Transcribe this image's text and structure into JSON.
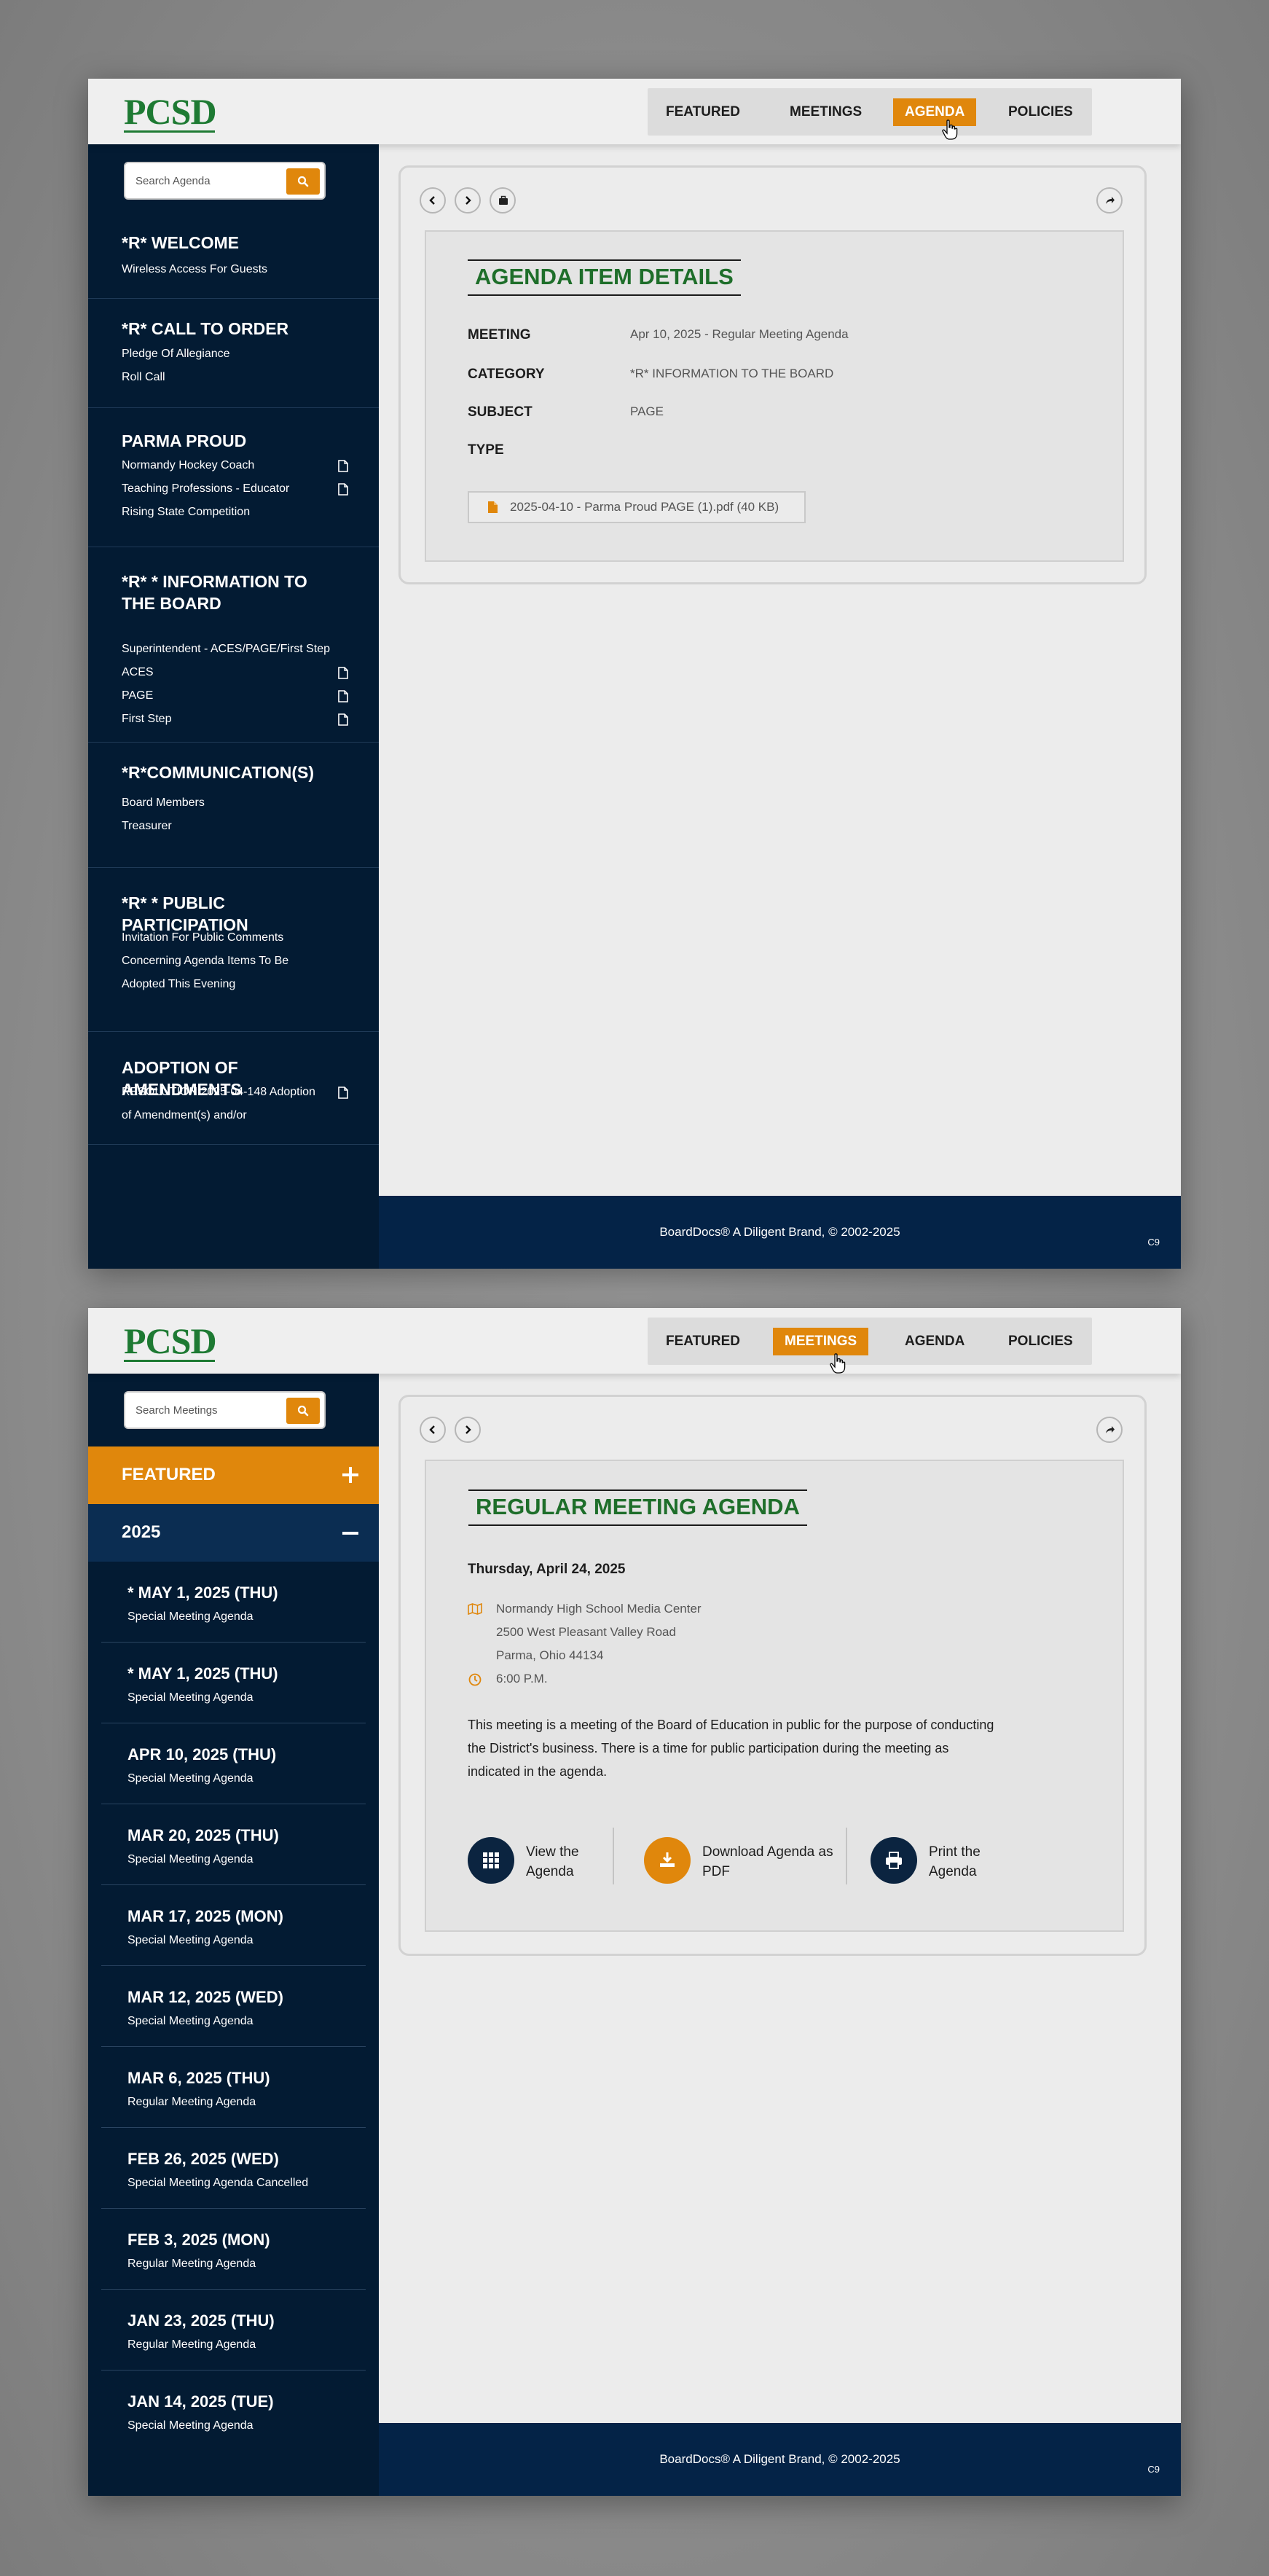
{
  "logo": "PCSD",
  "nav": [
    "FEATURED",
    "MEETINGS",
    "AGENDA",
    "POLICIES"
  ],
  "colors": {
    "brand_green": "#1e7a33",
    "accent_orange": "#e0870c",
    "sidebar_navy": "#031b33",
    "footer_navy": "#042347"
  },
  "footer": {
    "text": "BoardDocs® A Diligent Brand, © 2002-2025",
    "code": "C9"
  },
  "screen1": {
    "active_nav": "AGENDA",
    "search_placeholder": "Search Agenda",
    "sections": [
      {
        "title": "*R* WELCOME",
        "items": [
          {
            "label": "Wireless Access For Guests",
            "doc": false
          }
        ]
      },
      {
        "title": "*R* CALL TO ORDER",
        "items": [
          {
            "label": "Pledge Of Allegiance",
            "doc": false
          },
          {
            "label": "Roll Call",
            "doc": false
          }
        ]
      },
      {
        "title": "PARMA PROUD",
        "items": [
          {
            "label": "Normandy Hockey Coach",
            "doc": true
          },
          {
            "label": "Teaching Professions - Educator",
            "doc": true
          },
          {
            "label": "Rising State Competition",
            "doc": false
          }
        ]
      },
      {
        "title": "*R* * INFORMATION TO THE BOARD",
        "items": [
          {
            "label": "Superintendent - ACES/PAGE/First Step",
            "doc": false
          },
          {
            "label": "ACES",
            "doc": true
          },
          {
            "label": "PAGE",
            "doc": true
          },
          {
            "label": "First Step",
            "doc": true
          }
        ]
      },
      {
        "title": "*R*COMMUNICATION(S)",
        "items": [
          {
            "label": "Board Members",
            "doc": false
          },
          {
            "label": "Treasurer",
            "doc": false
          }
        ]
      },
      {
        "title": "*R* * PUBLIC PARTICIPATION",
        "items": [
          {
            "label": "Invitation For Public Comments",
            "doc": false
          },
          {
            "label": "Concerning Agenda Items To Be",
            "doc": false
          },
          {
            "label": "Adopted This Evening",
            "doc": false
          }
        ]
      },
      {
        "title": "ADOPTION OF AMENDMENTS",
        "items": [
          {
            "label": "RESOLUTION 2025-04-148 Adoption",
            "doc": true
          },
          {
            "label": "of Amendment(s) and/or",
            "doc": false
          }
        ]
      }
    ],
    "detail": {
      "title": "AGENDA ITEM DETAILS",
      "rows": [
        {
          "label": "MEETING",
          "value": "Apr 10, 2025 - Regular Meeting Agenda"
        },
        {
          "label": "CATEGORY",
          "value": "*R* INFORMATION TO THE BOARD"
        },
        {
          "label": "SUBJECT",
          "value": "PAGE"
        },
        {
          "label": "TYPE",
          "value": ""
        }
      ],
      "attachment": "2025-04-10 - Parma Proud PAGE (1).pdf (40 KB)"
    }
  },
  "screen2": {
    "active_nav": "MEETINGS",
    "search_placeholder": "Search Meetings",
    "featured_label": "FEATURED",
    "year_label": "2025",
    "meetings": [
      {
        "date": "* MAY 1, 2025 (THU)",
        "type": "Special Meeting Agenda"
      },
      {
        "date": "* MAY 1, 2025 (THU)",
        "type": "Special Meeting Agenda"
      },
      {
        "date": "APR 10, 2025 (THU)",
        "type": "Special Meeting Agenda"
      },
      {
        "date": "MAR 20, 2025 (THU)",
        "type": "Special Meeting Agenda"
      },
      {
        "date": "MAR 17, 2025 (MON)",
        "type": "Special Meeting Agenda"
      },
      {
        "date": "MAR 12, 2025 (WED)",
        "type": "Special Meeting Agenda"
      },
      {
        "date": "MAR 6, 2025 (THU)",
        "type": "Regular Meeting Agenda"
      },
      {
        "date": "FEB 26, 2025 (WED)",
        "type": "Special Meeting Agenda Cancelled"
      },
      {
        "date": "FEB 3, 2025 (MON)",
        "type": "Regular Meeting Agenda"
      },
      {
        "date": "JAN 23, 2025 (THU)",
        "type": "Regular Meeting Agenda"
      },
      {
        "date": "JAN 14, 2025 (TUE)",
        "type": "Special Meeting Agenda"
      }
    ],
    "detail": {
      "title": "REGULAR MEETING AGENDA",
      "date": "Thursday, April 24, 2025",
      "location": [
        "Normandy High School Media Center",
        "2500 West Pleasant Valley Road",
        "Parma, Ohio 44134"
      ],
      "time": "6:00 P.M.",
      "description": "This meeting is a meeting of the Board of Education in public for the purpose of conducting the District's business. There is a time for public participation during the meeting as indicated in the agenda.",
      "actions": [
        "View the Agenda",
        "Download Agenda as PDF",
        "Print the Agenda"
      ]
    }
  }
}
